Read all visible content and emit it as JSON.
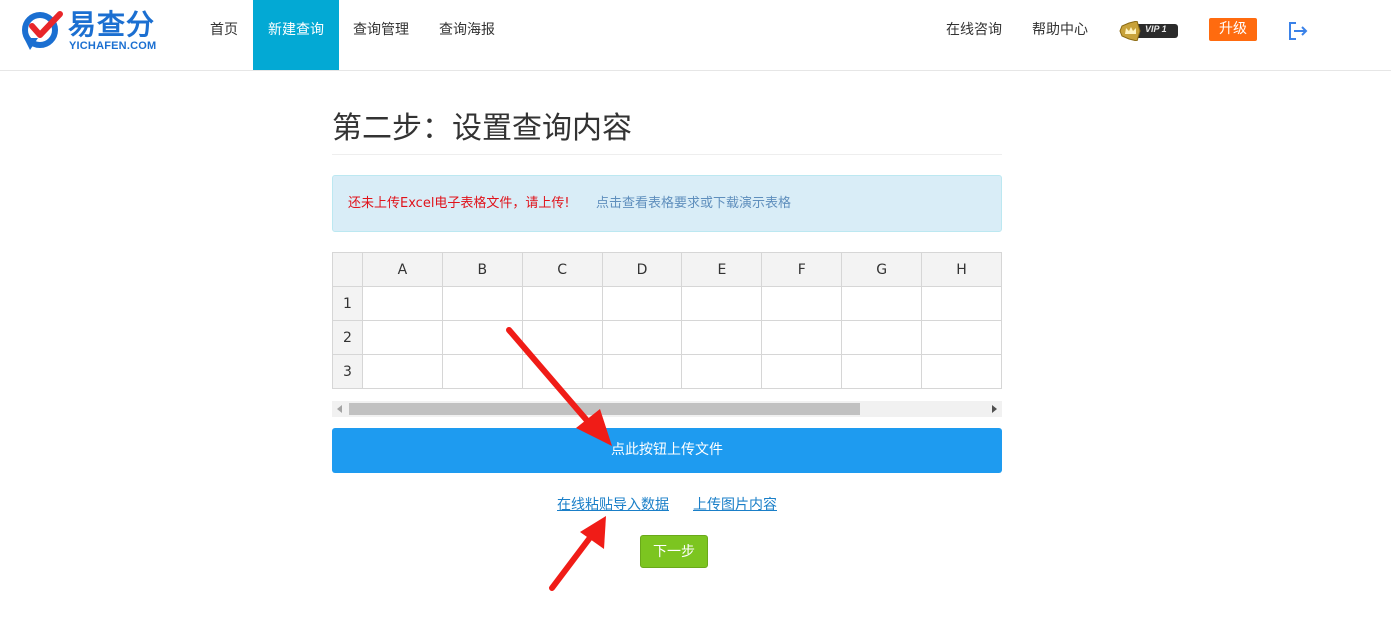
{
  "header": {
    "logo_cn": "易查分",
    "logo_en": "YICHAFEN.COM",
    "nav": [
      "首页",
      "新建查询",
      "查询管理",
      "查询海报"
    ],
    "active_nav": "新建查询",
    "online_consult": "在线咨询",
    "help_center": "帮助中心",
    "vip_label": "VIP 1",
    "upgrade_label": "升级",
    "icons": {
      "logo": "logo-check-icon",
      "vip": "crown-icon",
      "logout": "logout-icon"
    },
    "colors": {
      "active_bg": "#03a9d4",
      "upgrade_bg": "#ff6b0f"
    }
  },
  "main": {
    "title": "第二步：设置查询内容",
    "alert_warning": "还未上传Excel电子表格文件，请上传!",
    "alert_link": "点击查看表格要求或下载演示表格",
    "grid": {
      "columns": [
        "A",
        "B",
        "C",
        "D",
        "E",
        "F",
        "G",
        "H"
      ],
      "rows": [
        "1",
        "2",
        "3"
      ]
    },
    "upload_button": "点此按钮上传文件",
    "paste_link": "在线粘贴导入数据",
    "image_link": "上传图片内容",
    "next_button": "下一步",
    "colors": {
      "upload_bg": "#1e9bf0",
      "next_bg": "#7cc520",
      "warning": "#e0131b"
    }
  }
}
